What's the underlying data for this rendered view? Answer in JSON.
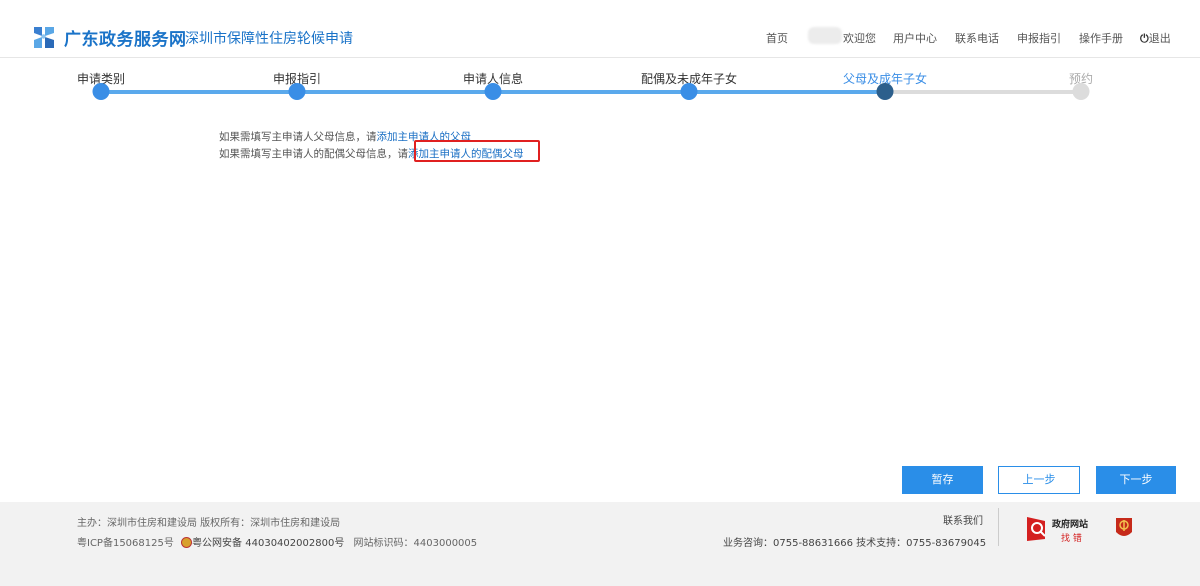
{
  "header": {
    "site_name": "广东政务服务网",
    "site_sub": "深圳市保障性住房轮候申请",
    "nav": {
      "home": "首页",
      "welcome": "欢迎您",
      "user_center": "用户中心",
      "contact_phone": "联系电话",
      "guide": "申报指引",
      "manual": "操作手册",
      "logout": "退出"
    }
  },
  "steps": [
    {
      "label": "申请类别",
      "state": "done"
    },
    {
      "label": "申报指引",
      "state": "done"
    },
    {
      "label": "申请人信息",
      "state": "done"
    },
    {
      "label": "配偶及未成年子女",
      "state": "done"
    },
    {
      "label": "父母及成年子女",
      "state": "current"
    },
    {
      "label": "预约",
      "state": "todo"
    }
  ],
  "content": {
    "line1_prefix": "如果需填写主申请人父母信息，请",
    "line1_link": "添加主申请人的父母",
    "line2_prefix": "如果需填写主申请人的配偶父母信息，请",
    "line2_link": "添加主申请人的配偶父母"
  },
  "buttons": {
    "save": "暂存",
    "prev": "上一步",
    "next": "下一步"
  },
  "footer": {
    "host": "主办：深圳市住房和建设局 版权所有：深圳市住房和建设局",
    "icp": "粤ICP备15068125号",
    "police": "粤公网安备 44030402002800号",
    "site_code": "网站标识码：4403000005",
    "contact_us": "联系我们",
    "hotline": "业务咨询：0755-88631666 技术支持：0755-83679045",
    "gov_badge_line1": "政府网站",
    "gov_badge_line2": "找 错"
  },
  "colors": {
    "accent": "#2a8ee8",
    "progress_done": "#5aa9ec",
    "progress_todo": "#dcdcdc",
    "current_dot": "#2c5f8c",
    "highlight": "#e02020"
  }
}
